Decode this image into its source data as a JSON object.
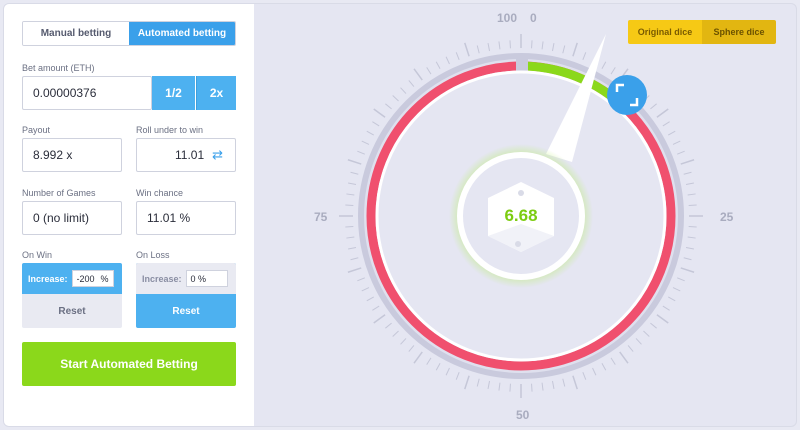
{
  "tabs": {
    "manual": "Manual betting",
    "automated": "Automated betting"
  },
  "bet_amount": {
    "label": "Bet amount (ETH)",
    "value": "0.00000376",
    "half": "1/2",
    "double": "2x"
  },
  "payout": {
    "label": "Payout",
    "value": "8.992 x"
  },
  "roll_under": {
    "label": "Roll under to win",
    "value": "11.01"
  },
  "num_games": {
    "label": "Number of Games",
    "value": "0 (no limit)"
  },
  "win_chance": {
    "label": "Win chance",
    "value": "11.01 %"
  },
  "on_win": {
    "label": "On Win",
    "increase_label": "Increase:",
    "increase_value": "-200",
    "pct": "%",
    "reset": "Reset"
  },
  "on_loss": {
    "label": "On Loss",
    "increase_label": "Increase:",
    "increase_value": "0 %",
    "reset": "Reset"
  },
  "start_button": "Start Automated Betting",
  "dice_toggle": {
    "original": "Original dice",
    "sphere": "Sphere dice"
  },
  "wheel": {
    "label_100": "100",
    "label_0": "0",
    "label_25": "25",
    "label_50": "50",
    "label_75": "75",
    "result": "6.68",
    "win_range": 11.01
  },
  "colors": {
    "accent": "#3aa0ea",
    "win": "#8bd81b",
    "lose": "#f0506e",
    "gold": "#f6c915"
  }
}
